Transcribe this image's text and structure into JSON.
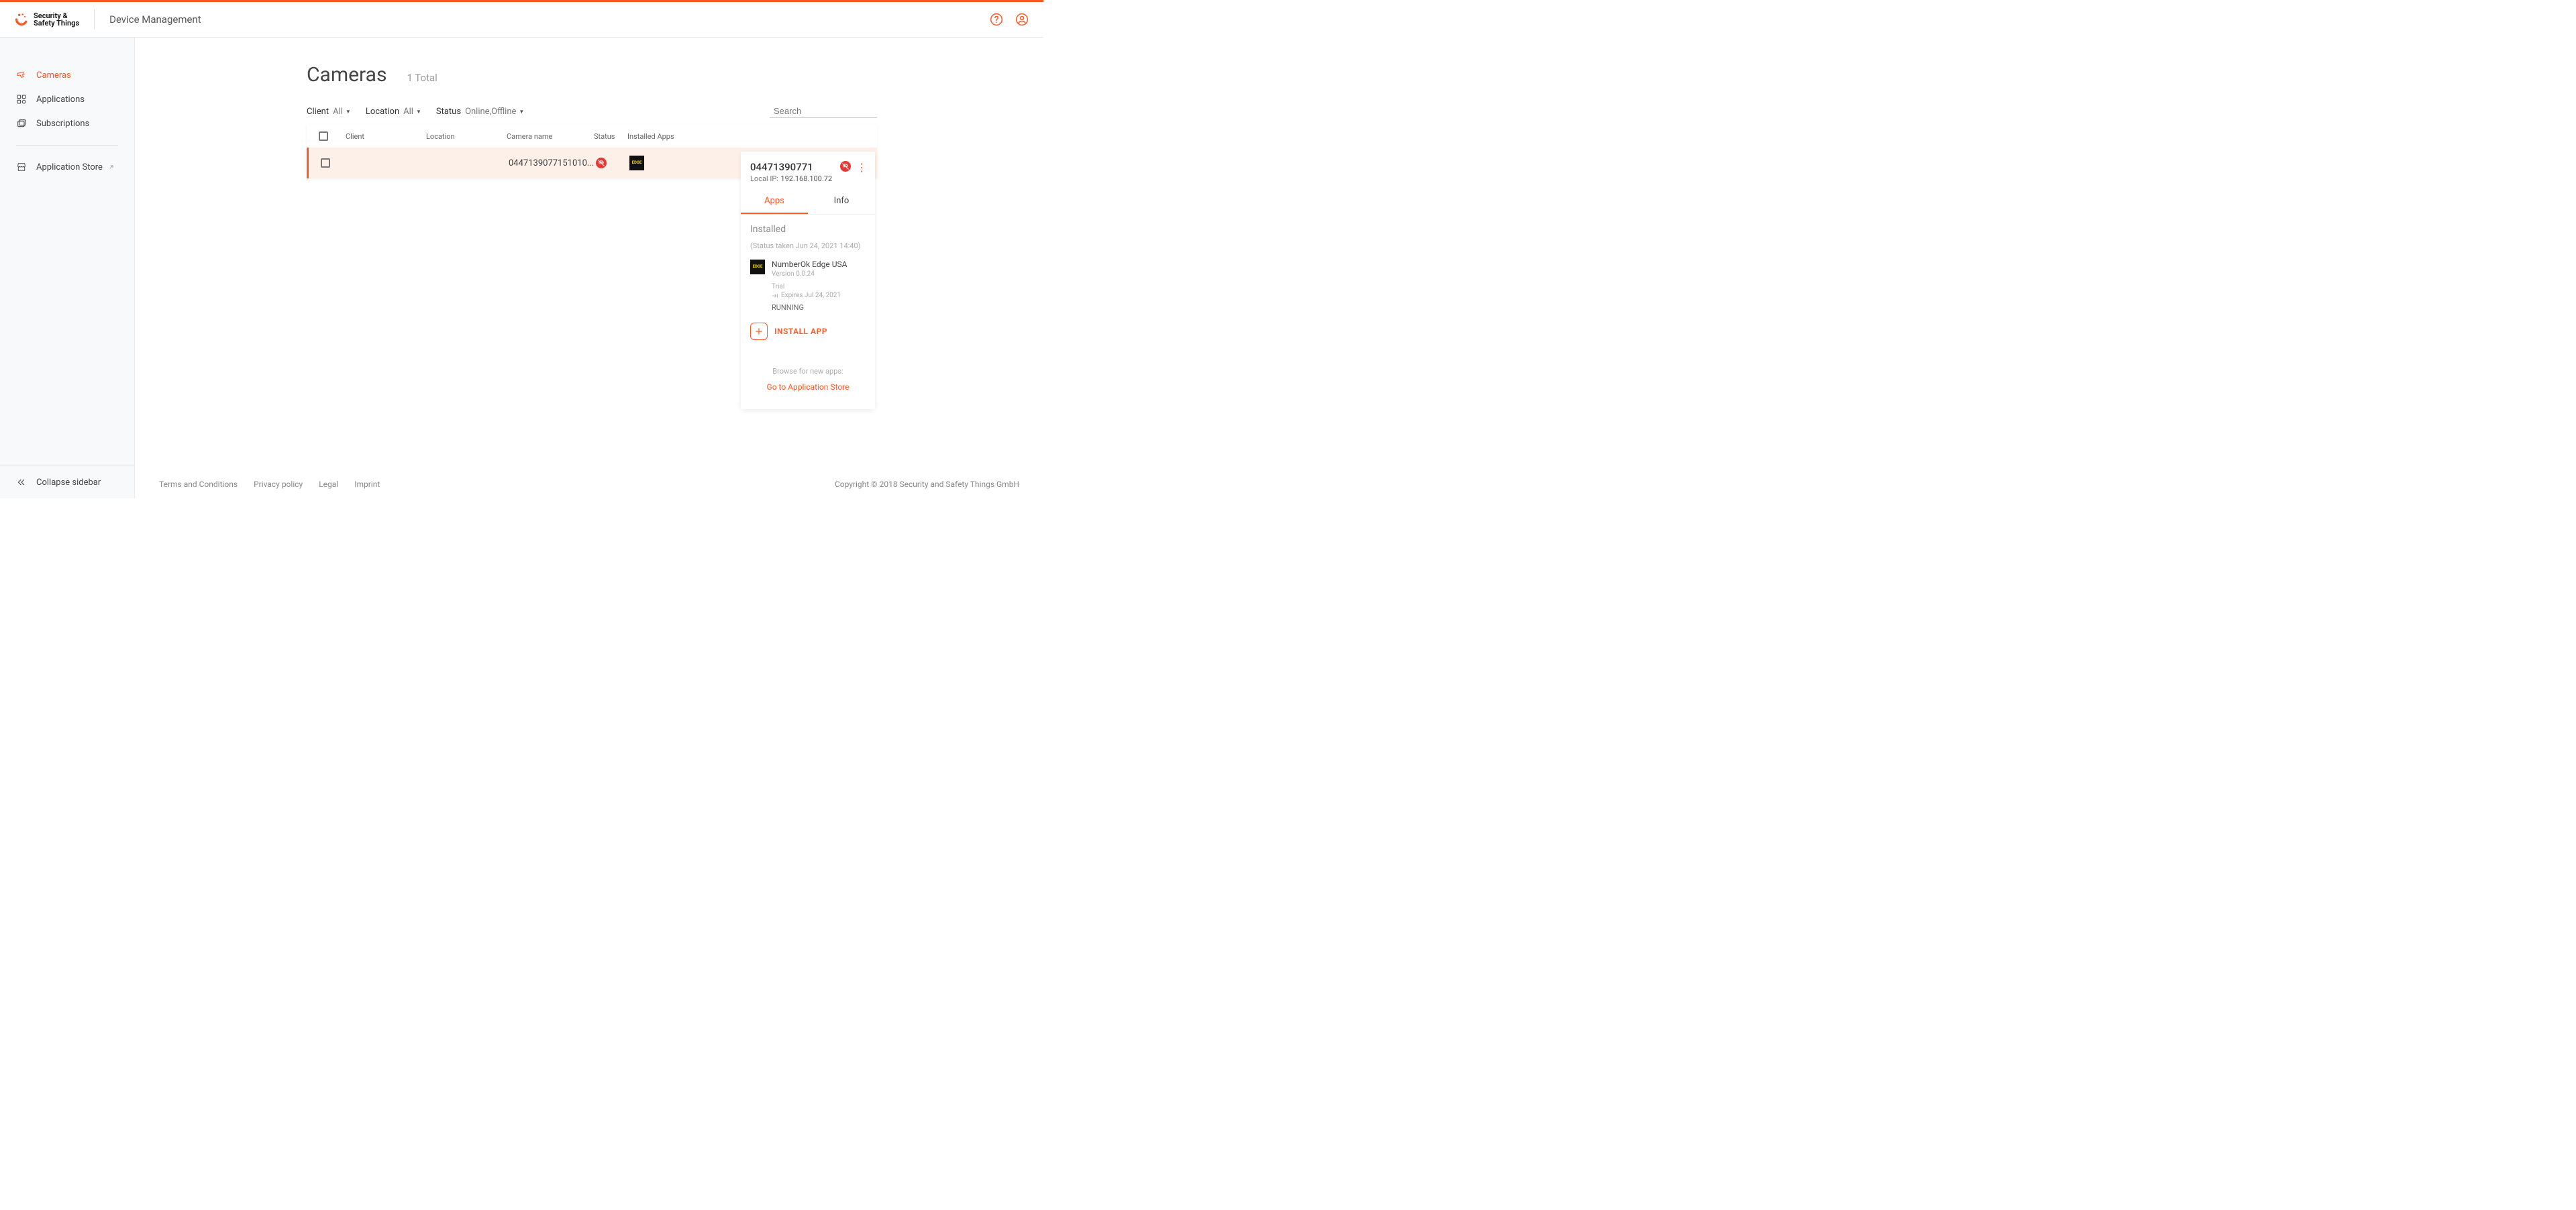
{
  "brand": {
    "line1": "Security &",
    "line2": "Safety Things"
  },
  "header": {
    "product": "Device Management"
  },
  "sidebar": {
    "items": [
      {
        "label": "Cameras"
      },
      {
        "label": "Applications"
      },
      {
        "label": "Subscriptions"
      },
      {
        "label": "Application Store"
      }
    ],
    "collapse": "Collapse sidebar"
  },
  "page": {
    "title": "Cameras",
    "total": "1 Total"
  },
  "filters": {
    "client_label": "Client",
    "client_value": "All",
    "location_label": "Location",
    "location_value": "All",
    "status_label": "Status",
    "status_value": "Online,Offline"
  },
  "search": {
    "placeholder": "Search"
  },
  "table": {
    "headers": {
      "client": "Client",
      "location": "Location",
      "camera_name": "Camera name",
      "status": "Status",
      "installed_apps": "Installed Apps"
    },
    "rows": [
      {
        "client": "",
        "location": "",
        "camera_name": "0447139077151010...",
        "app_thumb_label": "EDGE"
      }
    ]
  },
  "detail": {
    "id": "04471390771",
    "local_ip_label": "Local IP:",
    "local_ip": "192.168.100.72",
    "tabs": {
      "apps": "Apps",
      "info": "Info"
    },
    "section": "Installed",
    "status_ts": "(Status taken Jun 24, 2021 14:40)",
    "app": {
      "name": "NumberOk Edge USA",
      "version": "Version 0.0.24",
      "trial": "Trial",
      "expires": "Expires Jul 24, 2021",
      "state": "RUNNING",
      "thumb_label": "EDGE"
    },
    "install_label": "INSTALL APP",
    "browse": "Browse for new apps:",
    "store": "Go to Application Store"
  },
  "footer": {
    "links": [
      "Terms and Conditions",
      "Privacy policy",
      "Legal",
      "Imprint"
    ],
    "copyright": "Copyright © 2018 Security and Safety Things GmbH"
  }
}
